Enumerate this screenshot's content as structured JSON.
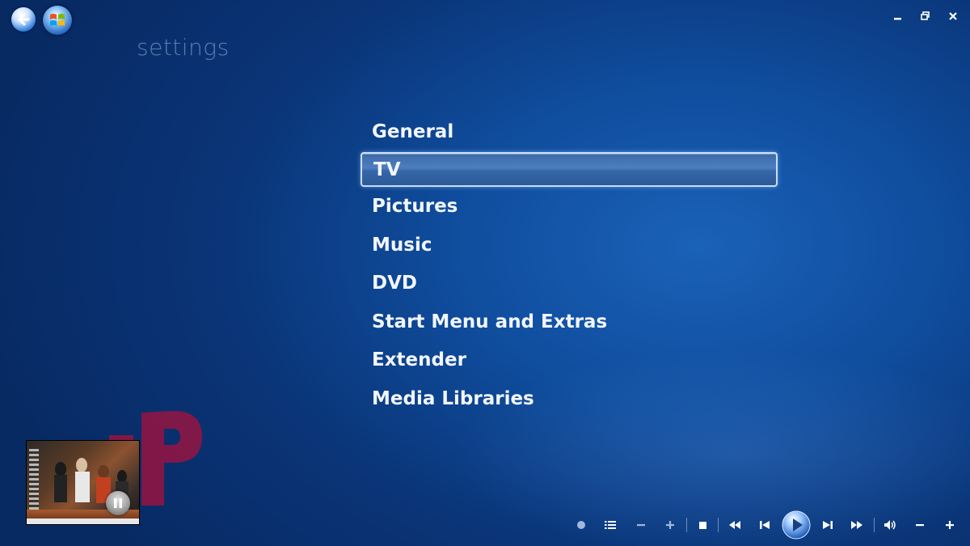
{
  "header": {
    "title": "settings",
    "back_icon": "back-arrow-icon",
    "start_icon": "windows-start-orb-icon"
  },
  "window_controls": {
    "minimize_icon": "minimize-icon",
    "restore_icon": "restore-icon",
    "close_icon": "close-icon"
  },
  "menu": {
    "selected_index": 1,
    "items": [
      {
        "label": "General"
      },
      {
        "label": "TV"
      },
      {
        "label": "Pictures"
      },
      {
        "label": "Music"
      },
      {
        "label": "DVD"
      },
      {
        "label": "Start Menu and Extras"
      },
      {
        "label": "Extender"
      },
      {
        "label": "Media Libraries"
      }
    ]
  },
  "now_playing": {
    "thumbnail": "live-tv-thumbnail",
    "pause_icon": "pause-icon"
  },
  "transport": {
    "icons": [
      "record-icon",
      "guide-list-icon",
      "channel-down-icon",
      "channel-up-icon",
      "stop-icon",
      "rewind-icon",
      "skip-back-icon",
      "play-icon",
      "skip-forward-icon",
      "fast-forward-icon",
      "mute-icon",
      "volume-down-icon",
      "volume-up-icon"
    ]
  },
  "colors": {
    "background": "#0f4c9c",
    "selection_border": "#c8dcf4",
    "title": "#a0bee6",
    "watermark": "#b01040"
  }
}
